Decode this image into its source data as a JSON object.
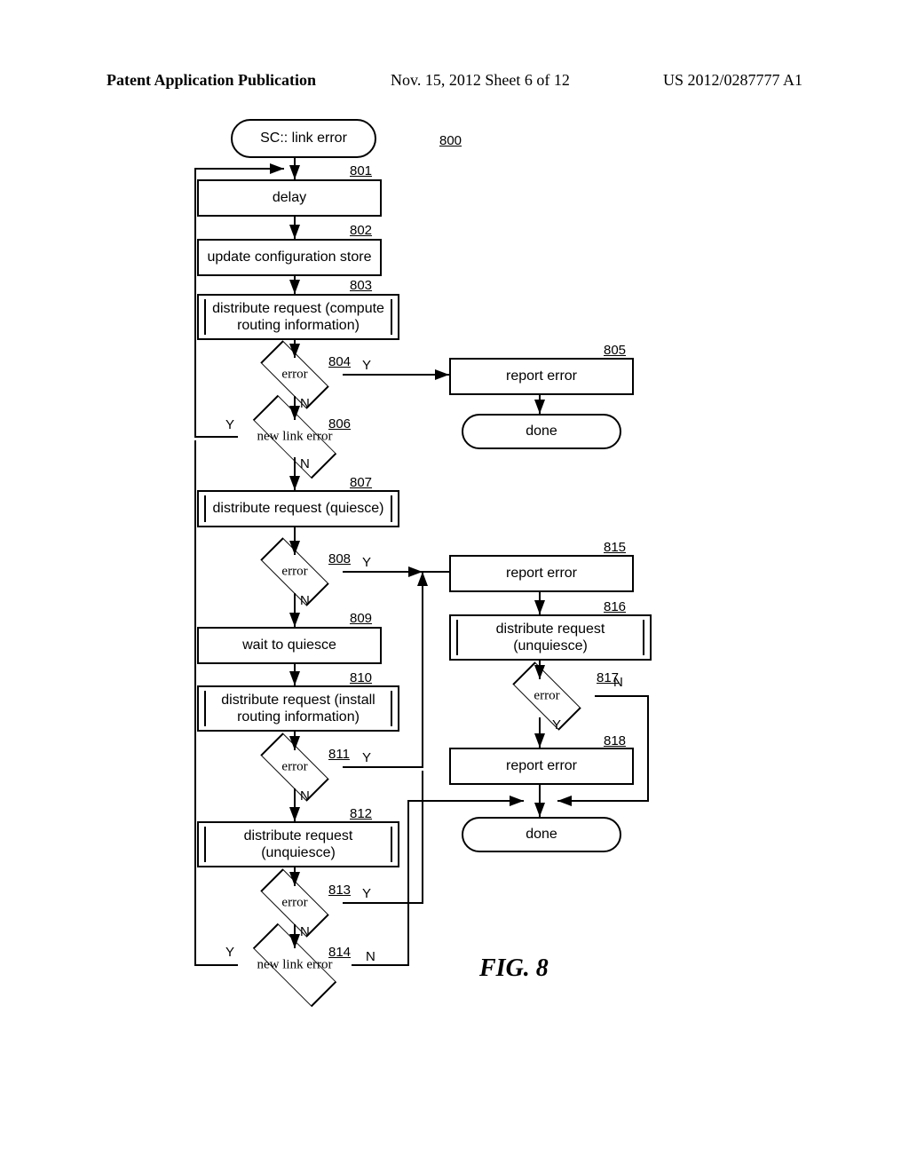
{
  "header": {
    "left": "Patent Application Publication",
    "mid": "Nov. 15, 2012   Sheet 6 of 12",
    "right": "US 2012/0287777 A1"
  },
  "figure_label": "FIG. 8",
  "diagram_ref": "800",
  "nodes": {
    "start": "SC:: link error",
    "s801": "delay",
    "s802": "update configuration store",
    "s803": "distribute request (compute routing information)",
    "d804": "error",
    "s805": "report error",
    "t805_done": "done",
    "d806": "new link error",
    "s807": "distribute request (quiesce)",
    "d808": "error",
    "s809": "wait to quiesce",
    "s810": "distribute request (install routing information)",
    "d811": "error",
    "s812": "distribute request (unquiesce)",
    "d813": "error",
    "d814": "new link error",
    "s815": "report error",
    "s816": "distribute request (unquiesce)",
    "d817": "error",
    "s818": "report error",
    "t818_done": "done"
  },
  "refs": {
    "r800": "800",
    "r801": "801",
    "r802": "802",
    "r803": "803",
    "r804": "804",
    "r805": "805",
    "r806": "806",
    "r807": "807",
    "r808": "808",
    "r809": "809",
    "r810": "810",
    "r811": "811",
    "r812": "812",
    "r813": "813",
    "r814": "814",
    "r815": "815",
    "r816": "816",
    "r817": "817",
    "r818": "818"
  },
  "labels": {
    "Y": "Y",
    "N": "N"
  },
  "chart_data": {
    "type": "flowchart",
    "title": "SC:: link error — 800",
    "nodes": [
      {
        "id": "start",
        "type": "terminator",
        "text": "SC:: link error"
      },
      {
        "id": "801",
        "type": "process",
        "text": "delay"
      },
      {
        "id": "802",
        "type": "process",
        "text": "update configuration store"
      },
      {
        "id": "803",
        "type": "subprocess",
        "text": "distribute request (compute routing information)"
      },
      {
        "id": "804",
        "type": "decision",
        "text": "error"
      },
      {
        "id": "805",
        "type": "process",
        "text": "report error"
      },
      {
        "id": "done1",
        "type": "terminator",
        "text": "done"
      },
      {
        "id": "806",
        "type": "decision",
        "text": "new link error"
      },
      {
        "id": "807",
        "type": "subprocess",
        "text": "distribute request (quiesce)"
      },
      {
        "id": "808",
        "type": "decision",
        "text": "error"
      },
      {
        "id": "809",
        "type": "process",
        "text": "wait to quiesce"
      },
      {
        "id": "810",
        "type": "subprocess",
        "text": "distribute request (install routing information)"
      },
      {
        "id": "811",
        "type": "decision",
        "text": "error"
      },
      {
        "id": "812",
        "type": "subprocess",
        "text": "distribute request (unquiesce)"
      },
      {
        "id": "813",
        "type": "decision",
        "text": "error"
      },
      {
        "id": "814",
        "type": "decision",
        "text": "new link error"
      },
      {
        "id": "815",
        "type": "process",
        "text": "report error"
      },
      {
        "id": "816",
        "type": "subprocess",
        "text": "distribute request (unquiesce)"
      },
      {
        "id": "817",
        "type": "decision",
        "text": "error"
      },
      {
        "id": "818",
        "type": "process",
        "text": "report error"
      },
      {
        "id": "done2",
        "type": "terminator",
        "text": "done"
      }
    ],
    "edges": [
      {
        "from": "start",
        "to": "801"
      },
      {
        "from": "801",
        "to": "802"
      },
      {
        "from": "802",
        "to": "803"
      },
      {
        "from": "803",
        "to": "804"
      },
      {
        "from": "804",
        "to": "805",
        "label": "Y"
      },
      {
        "from": "805",
        "to": "done1"
      },
      {
        "from": "804",
        "to": "806",
        "label": "N"
      },
      {
        "from": "806",
        "to": "801",
        "label": "Y"
      },
      {
        "from": "806",
        "to": "807",
        "label": "N"
      },
      {
        "from": "807",
        "to": "808"
      },
      {
        "from": "808",
        "to": "815",
        "label": "Y"
      },
      {
        "from": "808",
        "to": "809",
        "label": "N"
      },
      {
        "from": "809",
        "to": "810"
      },
      {
        "from": "810",
        "to": "811"
      },
      {
        "from": "811",
        "to": "815",
        "label": "Y"
      },
      {
        "from": "811",
        "to": "812",
        "label": "N"
      },
      {
        "from": "812",
        "to": "813"
      },
      {
        "from": "813",
        "to": "815",
        "label": "Y"
      },
      {
        "from": "813",
        "to": "814",
        "label": "N"
      },
      {
        "from": "814",
        "to": "done2",
        "label": "N"
      },
      {
        "from": "814",
        "to": "801",
        "label": "Y"
      },
      {
        "from": "815",
        "to": "816"
      },
      {
        "from": "816",
        "to": "817"
      },
      {
        "from": "817",
        "to": "818",
        "label": "Y"
      },
      {
        "from": "817",
        "to": "done2",
        "label": "N"
      },
      {
        "from": "818",
        "to": "done2"
      }
    ]
  }
}
